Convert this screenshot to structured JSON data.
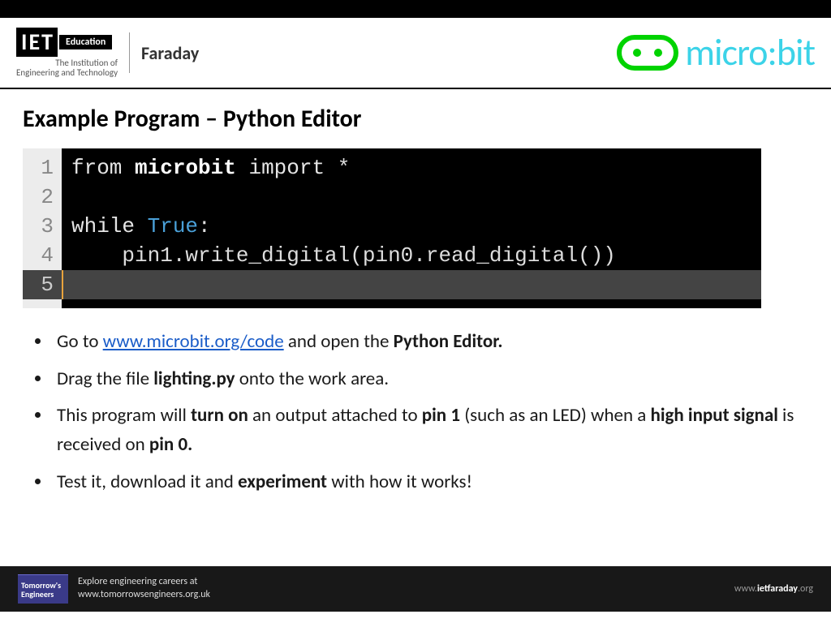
{
  "header": {
    "iet_education": "Education",
    "iet_line1": "The Institution of",
    "iet_line2": "Engineering and Technology",
    "faraday": "Faraday",
    "microbit": "micro:bit"
  },
  "title": "Example Program – Python Editor",
  "code": {
    "line1_from": "from",
    "line1_mod": "microbit",
    "line1_import": "import",
    "line1_star": "*",
    "line3_while": "while",
    "line3_true": "True",
    "line3_colon": ":",
    "line4": "    pin1.write_digital(pin0.read_digital())",
    "gutter": [
      "1",
      "2",
      "3",
      "4",
      "5"
    ]
  },
  "bullets": {
    "b1_pre": "Go to ",
    "b1_link": "www.microbit.org/code",
    "b1_post": " and open the ",
    "b1_bold": "Python Editor.",
    "b2_pre": "Drag the file ",
    "b2_bold": "lighting.py",
    "b2_post": " onto the work area.",
    "b3_pre": "This program will ",
    "b3_bold1": "turn on",
    "b3_mid1": " an output attached to ",
    "b3_bold2": "pin 1",
    "b3_mid2": " (such as an LED) when a ",
    "b3_bold3": "high input signal",
    "b3_mid3": " is received on ",
    "b3_bold4": "pin 0.",
    "b4_pre": "Test it, download it and ",
    "b4_bold": "experiment",
    "b4_post": " with how it works!"
  },
  "footer": {
    "te1": "Tomorrow's",
    "te2": "Engineers",
    "left1": "Explore engineering careers at",
    "left2": "www.tomorrowsengineers.org.uk",
    "right_w": "www.",
    "right_d": "ietfaraday",
    "right_o": ".org"
  }
}
